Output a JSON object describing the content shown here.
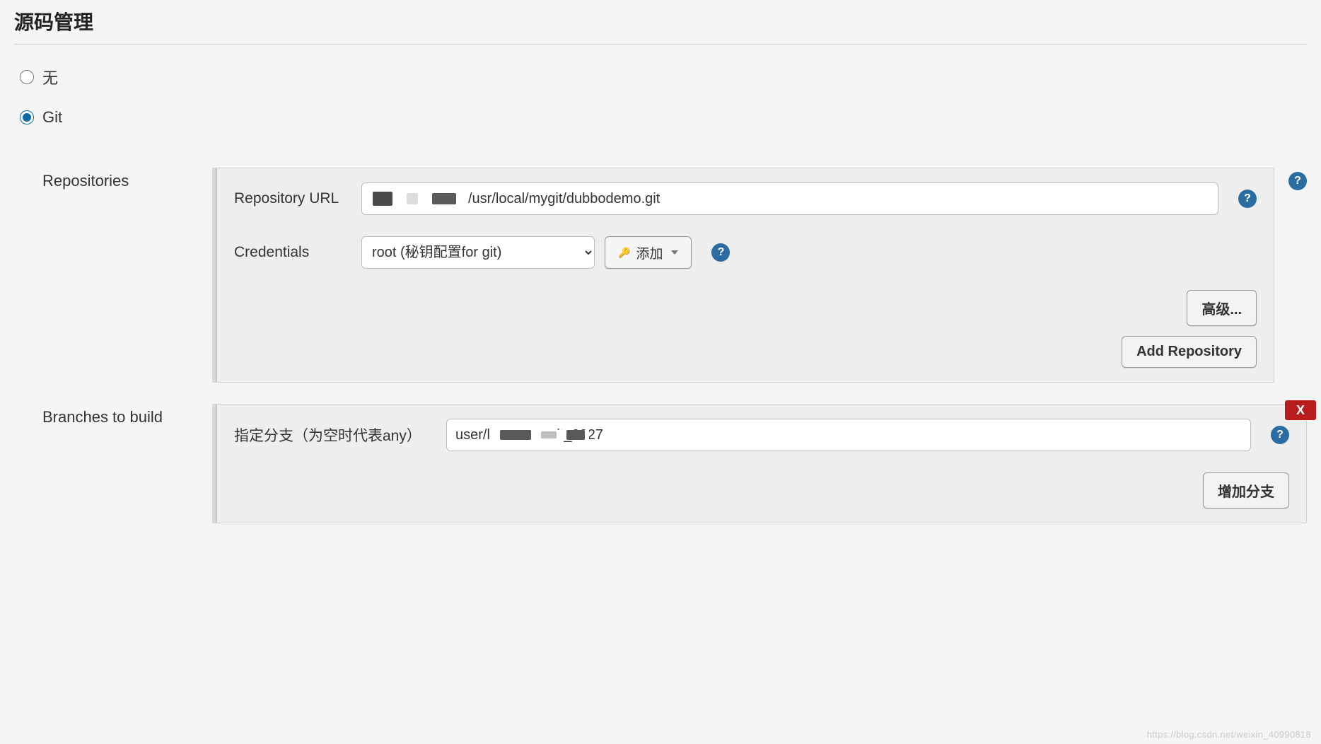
{
  "section_title": "源码管理",
  "scm_options": {
    "none_label": "无",
    "git_label": "Git",
    "selected": "git"
  },
  "repositories": {
    "label": "Repositories",
    "repo_url_label": "Repository URL",
    "repo_url_value": "/usr/local/mygit/dubbodemo.git",
    "credentials_label": "Credentials",
    "credentials_selected": "root (秘钥配置for git)",
    "add_credentials_label": "添加",
    "advanced_label": "高级...",
    "add_repository_label": "Add Repository"
  },
  "branches": {
    "label": "Branches to build",
    "specifier_label": "指定分支（为空时代表any）",
    "branch_value_prefix": "user/l",
    "branch_value_suffix": "it_0927",
    "add_branch_label": "增加分支",
    "delete_label": "X"
  },
  "watermark": "https://blog.csdn.net/weixin_40990818"
}
